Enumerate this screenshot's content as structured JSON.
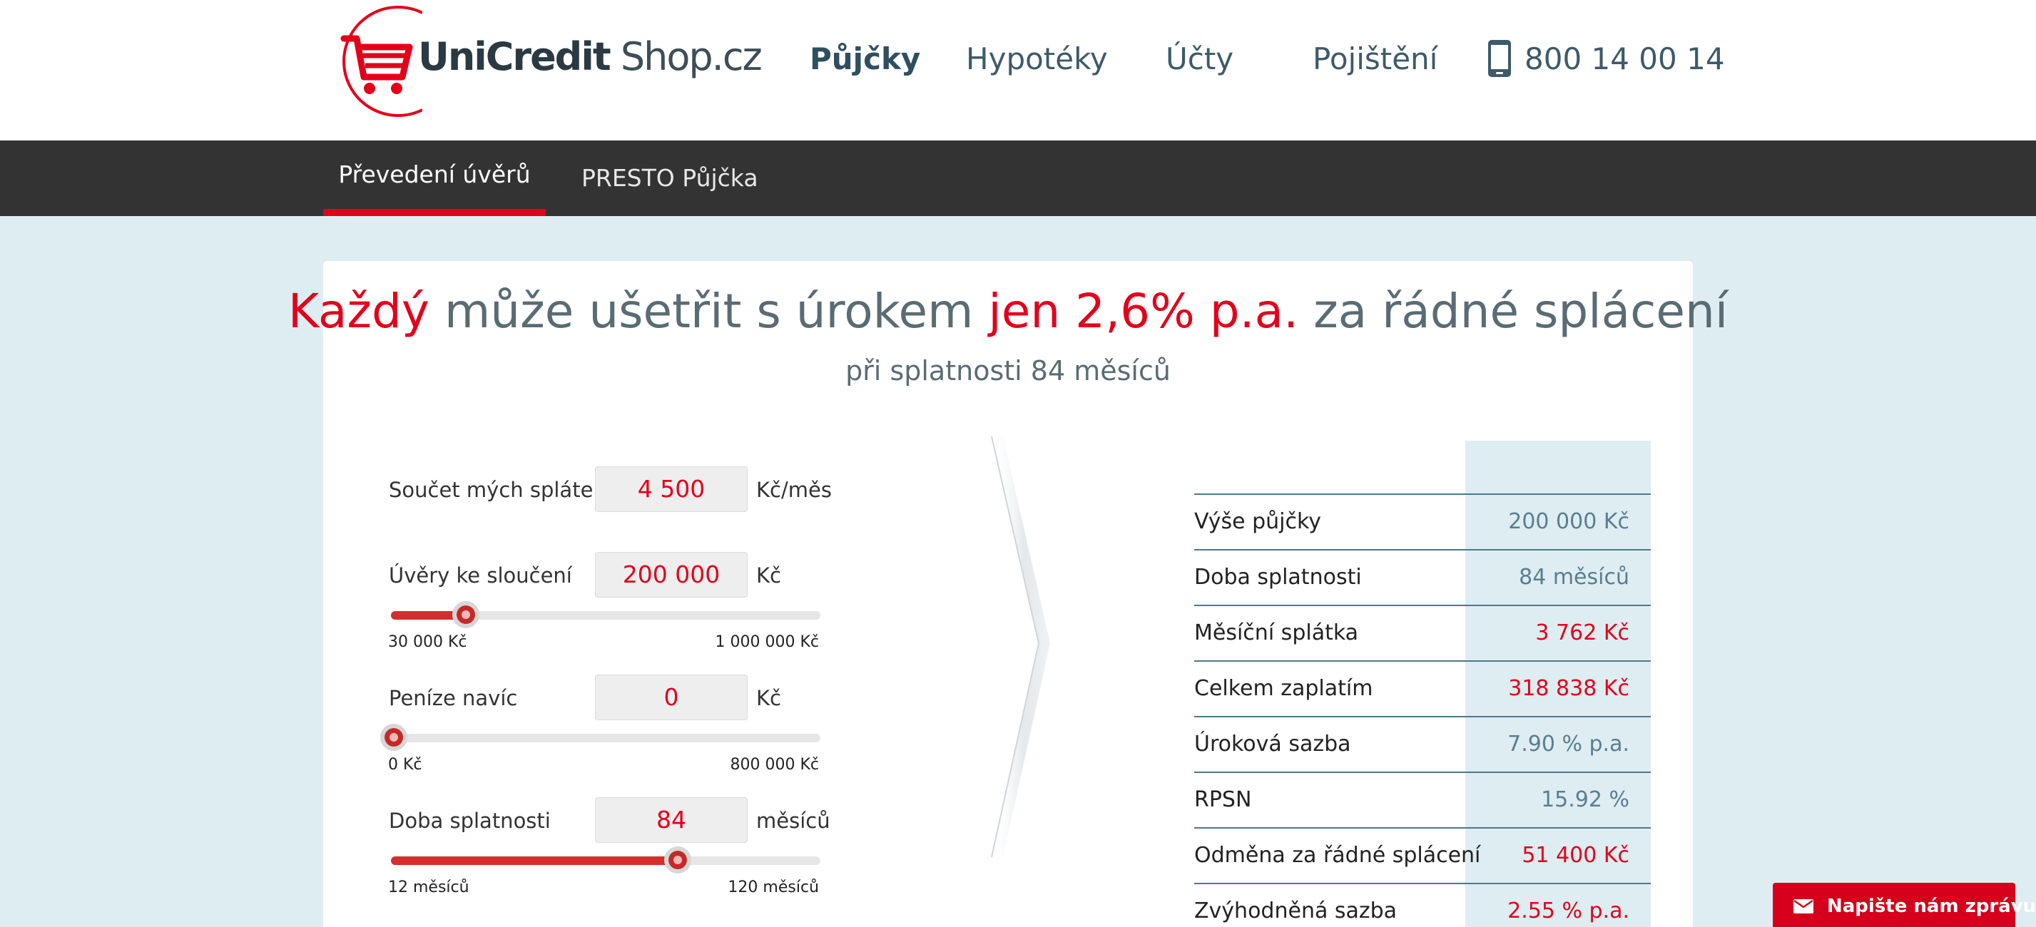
{
  "brand": {
    "name_bold": "UniCredit",
    "name_regular": " Shop.cz",
    "logo_color": "#e3001b"
  },
  "header": {
    "nav": [
      {
        "label": "Půjčky",
        "active": true
      },
      {
        "label": "Hypotéky",
        "active": false
      },
      {
        "label": "Účty",
        "active": false
      },
      {
        "label": "Pojištění",
        "active": false
      }
    ],
    "phone": "800 14 00 14"
  },
  "subnav": {
    "tabs": [
      {
        "label": "Převedení úvěrů",
        "active": true
      },
      {
        "label": "PRESTO Půjčka",
        "active": false
      }
    ]
  },
  "hero": {
    "part1": "Každý",
    "part2": " může ušetřit s úrokem ",
    "part3": "jen 2,6% p.a.",
    "part4": " za řádné splácení",
    "subtitle": "při splatnosti 84 měsíců"
  },
  "calculator": {
    "fields": [
      {
        "label": "Součet mých splátek",
        "value": "4 500",
        "unit": "Kč/měs"
      },
      {
        "label": "Úvěry ke sloučení",
        "value": "200 000",
        "unit": "Kč",
        "min": "30 000 Kč",
        "max": "1 000 000 Kč",
        "level": 0.175
      },
      {
        "label": "Peníze navíc",
        "value": "0",
        "unit": "Kč",
        "min": "0 Kč",
        "max": "800 000 Kč",
        "level": 0.0
      },
      {
        "label": "Doba splatnosti",
        "value": "84",
        "unit": "měsíců",
        "min": "12 měsíců",
        "max": "120 měsíců",
        "level": 0.667
      }
    ]
  },
  "results": [
    {
      "label": "Výše půjčky",
      "value": "200 000 Kč",
      "color": "blue"
    },
    {
      "label": "Doba splatnosti",
      "value": "84 měsíců",
      "color": "blue"
    },
    {
      "label": "Měsíční splátka",
      "value": "3 762 Kč",
      "color": "red"
    },
    {
      "label": "Celkem zaplatím",
      "value": "318 838 Kč",
      "color": "red"
    },
    {
      "label": "Úroková sazba",
      "value": "7.90 % p.a.",
      "color": "blue"
    },
    {
      "label": "RPSN",
      "value": "15.92 %",
      "color": "blue"
    },
    {
      "label": "Odměna za řádné splácení",
      "value": "51 400 Kč",
      "color": "red"
    },
    {
      "label": "Zvýhodněná sazba",
      "value": "2.55 % p.a.",
      "color": "red"
    }
  ],
  "message_button": {
    "label": "Napište nám zprávu"
  },
  "colors": {
    "accent": "#e3001b",
    "subnav_bg": "#333333",
    "page_bg": "#deedf2",
    "value_blue": "#5a7e8e"
  }
}
